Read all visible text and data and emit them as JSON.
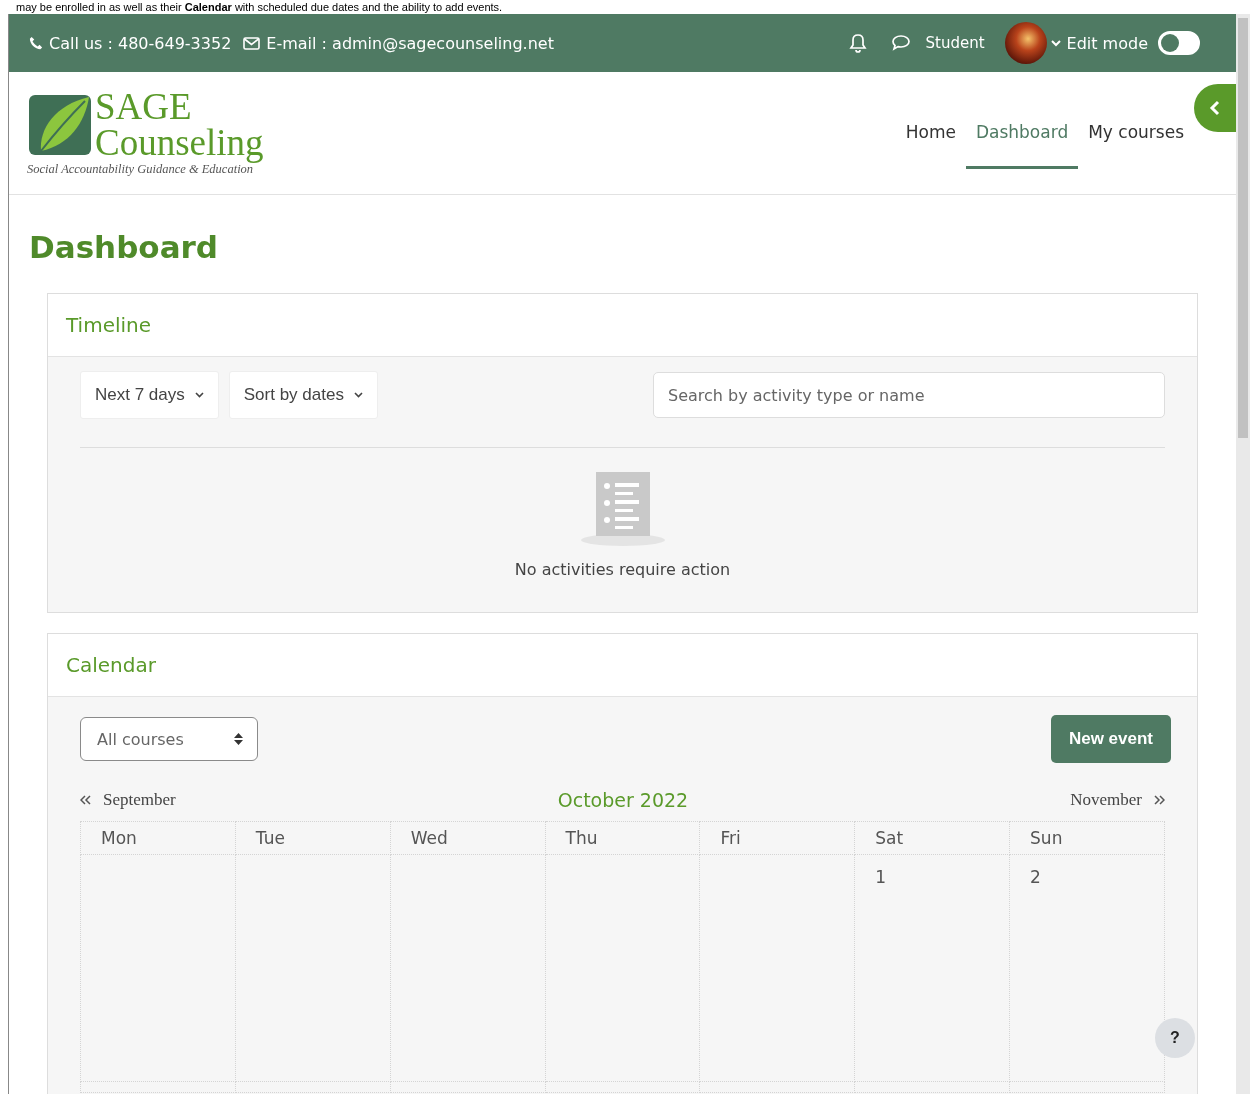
{
  "caption": "may be enrolled in as well as their **Calendar** with scheduled due dates and the ability to add events.",
  "topbar": {
    "phone": "Call us : 480-649-3352",
    "email": "E-mail : admin@sagecounseling.net",
    "user_role": "Student",
    "edit_mode": {
      "label": "Edit mode",
      "on": false
    }
  },
  "logo": {
    "title_line_1": "SAGE",
    "title_line_2": "Counseling",
    "tagline": "Social Accountability Guidance & Education"
  },
  "nav": [
    {
      "label": "Home",
      "selected": false
    },
    {
      "label": "Dashboard",
      "selected": true
    },
    {
      "label": "My courses",
      "selected": false
    }
  ],
  "page_title": "Dashboard",
  "timeline": {
    "title": "Timeline",
    "filters": [
      "Next 7 days",
      "Sort by dates"
    ],
    "search": {
      "placeholder": "Search by activity type or name"
    },
    "empty_message": "No activities require action"
  },
  "calendar": {
    "title": "Calendar",
    "course_select": "All courses",
    "new_event_button": "New event",
    "prev_month": "September",
    "month": "October 2022",
    "next_month": "November",
    "weekdays": [
      "Mon",
      "Tue",
      "Wed",
      "Thu",
      "Fri",
      "Sat",
      "Sun"
    ],
    "weeks": [
      {
        "sat": "1",
        "sun": "2"
      }
    ]
  },
  "help_button": "?"
}
